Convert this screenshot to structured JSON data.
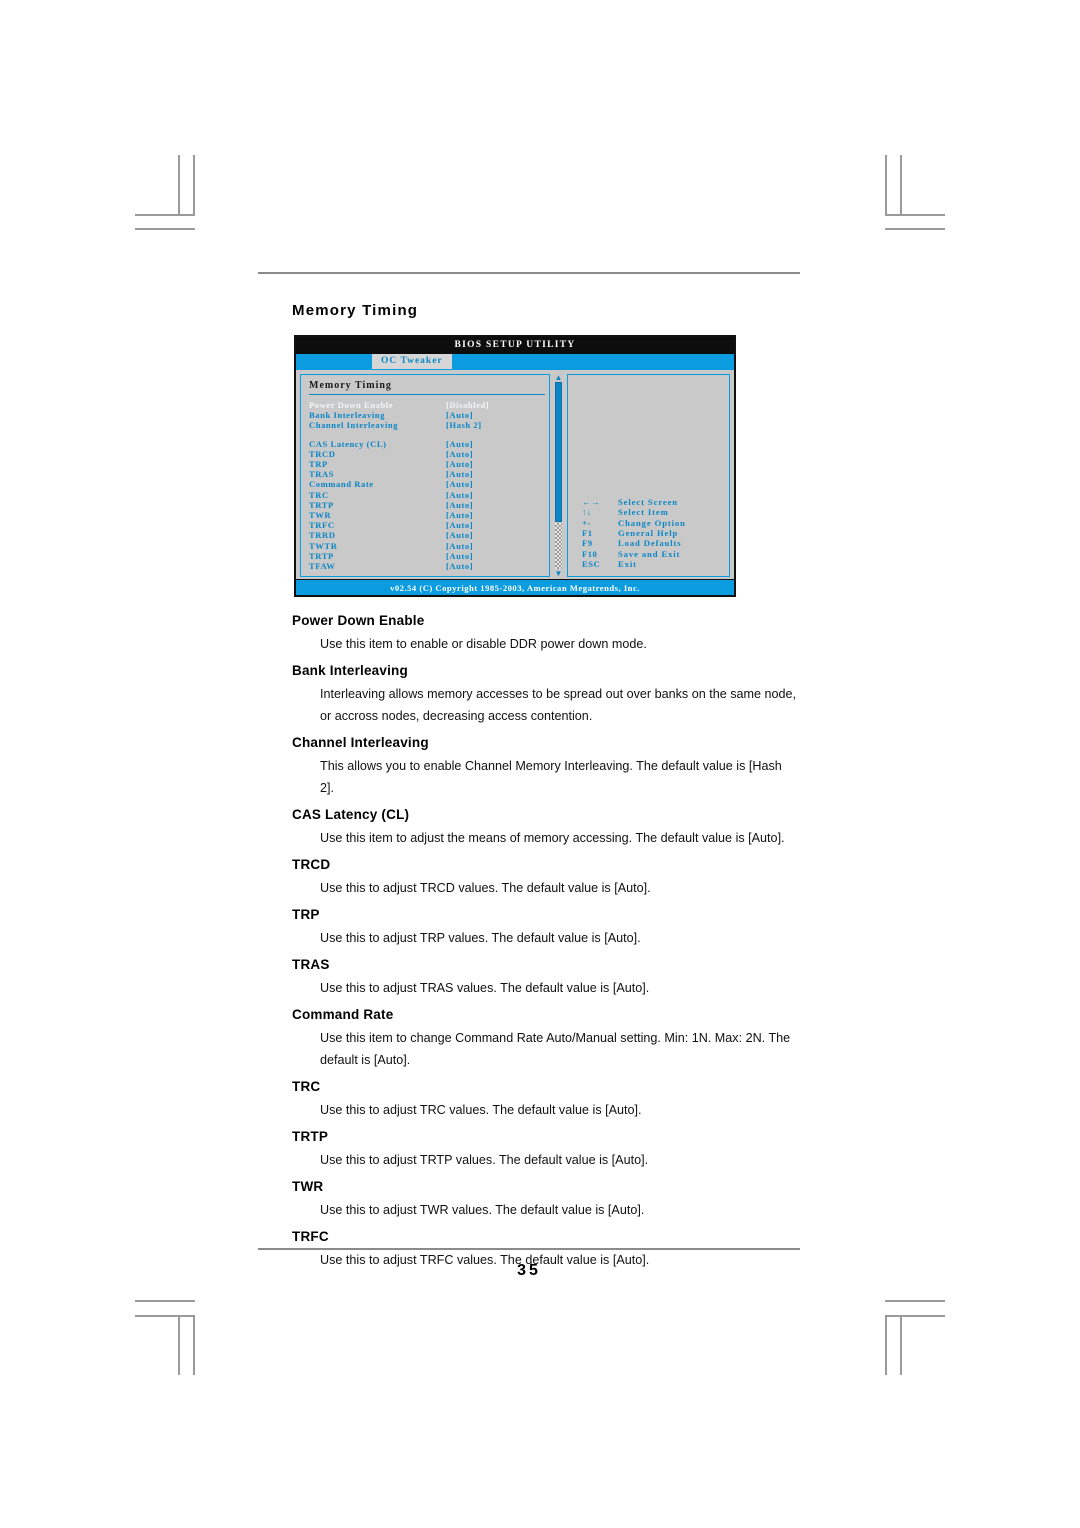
{
  "page": {
    "number": "35",
    "section_title": "Memory Timing"
  },
  "bios": {
    "title": "BIOS SETUP UTILITY",
    "tab_label": "OC Tweaker",
    "panel_heading": "Memory Timing",
    "footer": "v02.54 (C) Copyright 1985-2003, American Megatrends, Inc.",
    "scroll_up_icon": "▲",
    "scroll_down_icon": "▼",
    "options": [
      {
        "label": "Power Down Enable",
        "value": "[Disabled]",
        "selected": true,
        "gap_after": false
      },
      {
        "label": "Bank Interleaving",
        "value": "[Auto]",
        "selected": false,
        "gap_after": false
      },
      {
        "label": "Channel Interleaving",
        "value": "[Hash 2]",
        "selected": false,
        "gap_after": true
      },
      {
        "label": "CAS Latency (CL)",
        "value": "[Auto]",
        "selected": false,
        "gap_after": false
      },
      {
        "label": "TRCD",
        "value": "[Auto]",
        "selected": false,
        "gap_after": false
      },
      {
        "label": "TRP",
        "value": "[Auto]",
        "selected": false,
        "gap_after": false
      },
      {
        "label": "TRAS",
        "value": "[Auto]",
        "selected": false,
        "gap_after": false
      },
      {
        "label": "Command Rate",
        "value": "[Auto]",
        "selected": false,
        "gap_after": false
      },
      {
        "label": "TRC",
        "value": "[Auto]",
        "selected": false,
        "gap_after": false
      },
      {
        "label": "TRTP",
        "value": "[Auto]",
        "selected": false,
        "gap_after": false
      },
      {
        "label": "TWR",
        "value": "[Auto]",
        "selected": false,
        "gap_after": false
      },
      {
        "label": "TRFC",
        "value": "[Auto]",
        "selected": false,
        "gap_after": false
      },
      {
        "label": "TRRD",
        "value": "[Auto]",
        "selected": false,
        "gap_after": false
      },
      {
        "label": "TWTR",
        "value": "[Auto]",
        "selected": false,
        "gap_after": false
      },
      {
        "label": "TRTP",
        "value": "[Auto]",
        "selected": false,
        "gap_after": false
      },
      {
        "label": "TFAW",
        "value": "[Auto]",
        "selected": false,
        "gap_after": false
      }
    ],
    "legend": [
      {
        "key": "←→",
        "desc": "Select Screen"
      },
      {
        "key": "↑↓",
        "desc": "Select Item"
      },
      {
        "key": "+-",
        "desc": "Change Option"
      },
      {
        "key": "F1",
        "desc": "General Help"
      },
      {
        "key": "F9",
        "desc": "Load Defaults"
      },
      {
        "key": "F10",
        "desc": "Save and Exit"
      },
      {
        "key": "ESC",
        "desc": "Exit"
      }
    ]
  },
  "manual_entries": [
    {
      "title": "Power Down Enable",
      "desc": "Use this item to enable or disable DDR power down mode."
    },
    {
      "title": "Bank Interleaving",
      "desc": "Interleaving allows memory accesses to be spread out over banks on the same node, or accross nodes, decreasing access contention."
    },
    {
      "title": "Channel Interleaving",
      "desc": "This allows you to enable Channel Memory Interleaving. The default value is [Hash 2]."
    },
    {
      "title": "CAS Latency (CL)",
      "desc": "Use this item to adjust the means of memory accessing. The default value is [Auto]."
    },
    {
      "title": "TRCD",
      "desc": "Use this to adjust TRCD values. The default value is [Auto]."
    },
    {
      "title": "TRP",
      "desc": "Use this to adjust TRP values. The default value is [Auto]."
    },
    {
      "title": "TRAS",
      "desc": "Use this to adjust TRAS values. The default value is [Auto]."
    },
    {
      "title": "Command Rate",
      "desc": "Use this item to change Command Rate Auto/Manual setting. Min: 1N. Max: 2N. The default is [Auto]."
    },
    {
      "title": "TRC",
      "desc": "Use this to adjust TRC values. The default value is [Auto]."
    },
    {
      "title": "TRTP",
      "desc": "Use this to adjust TRTP values. The default value is [Auto]."
    },
    {
      "title": "TWR",
      "desc": "Use this to adjust TWR values. The default value is [Auto]."
    },
    {
      "title": "TRFC",
      "desc": "Use this to adjust TRFC values. The default value is [Auto]."
    }
  ],
  "colors": {
    "bios_blue": "#0b9ce0",
    "bios_text_blue": "#0b86c6",
    "bios_panel_gray": "#c9c9c9",
    "title_black": "#0d0d0d"
  }
}
